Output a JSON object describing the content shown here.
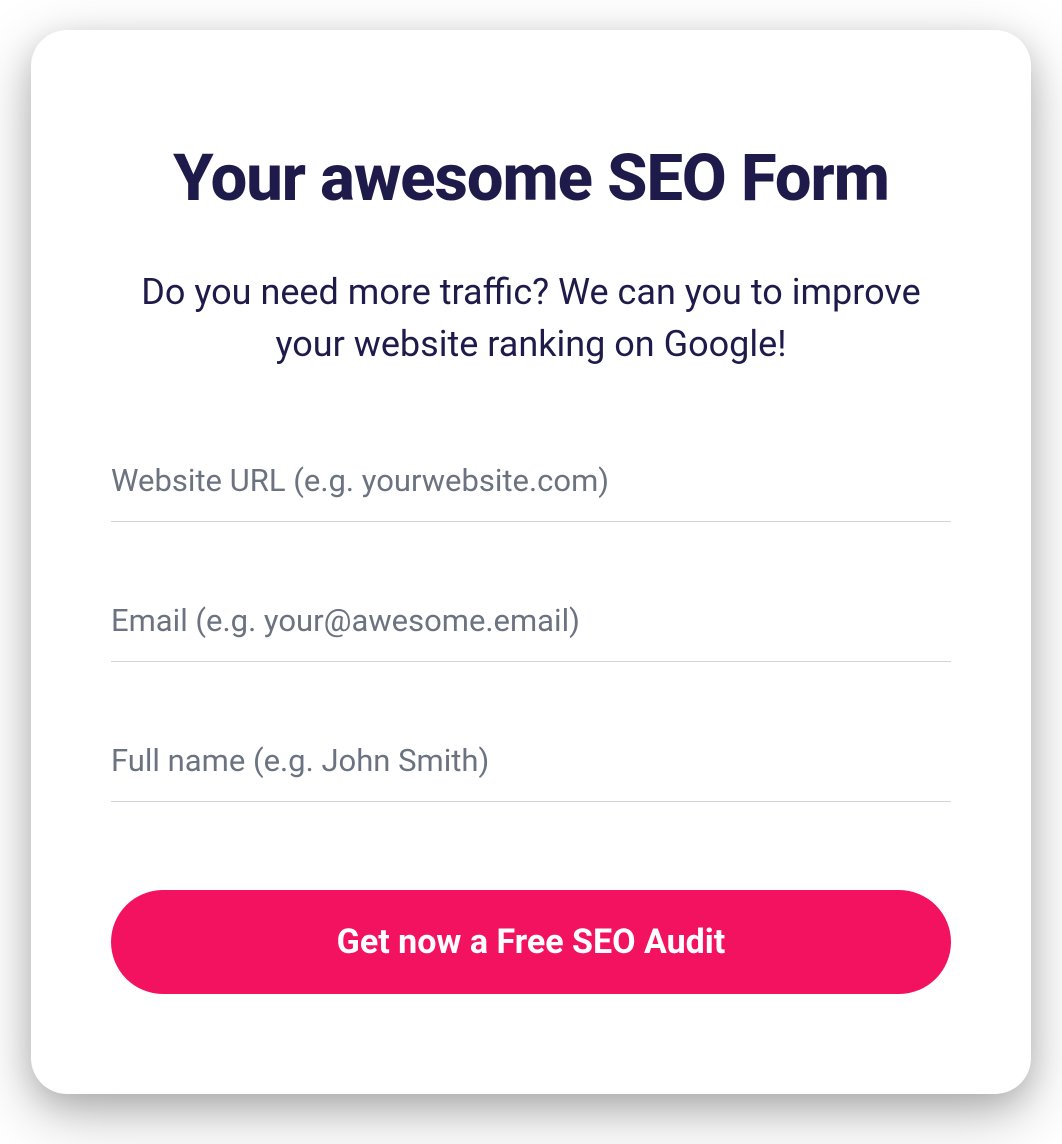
{
  "form": {
    "title": "Your awesome SEO Form",
    "subtitle": "Do you need more traffic? We can you to improve your website ranking on Google!",
    "fields": {
      "website": {
        "placeholder": "Website URL (e.g. yourwebsite.com)",
        "value": ""
      },
      "email": {
        "placeholder": "Email (e.g. your@awesome.email)",
        "value": ""
      },
      "fullname": {
        "placeholder": "Full name (e.g. John Smith)",
        "value": ""
      }
    },
    "submit_label": "Get now a Free SEO Audit"
  }
}
